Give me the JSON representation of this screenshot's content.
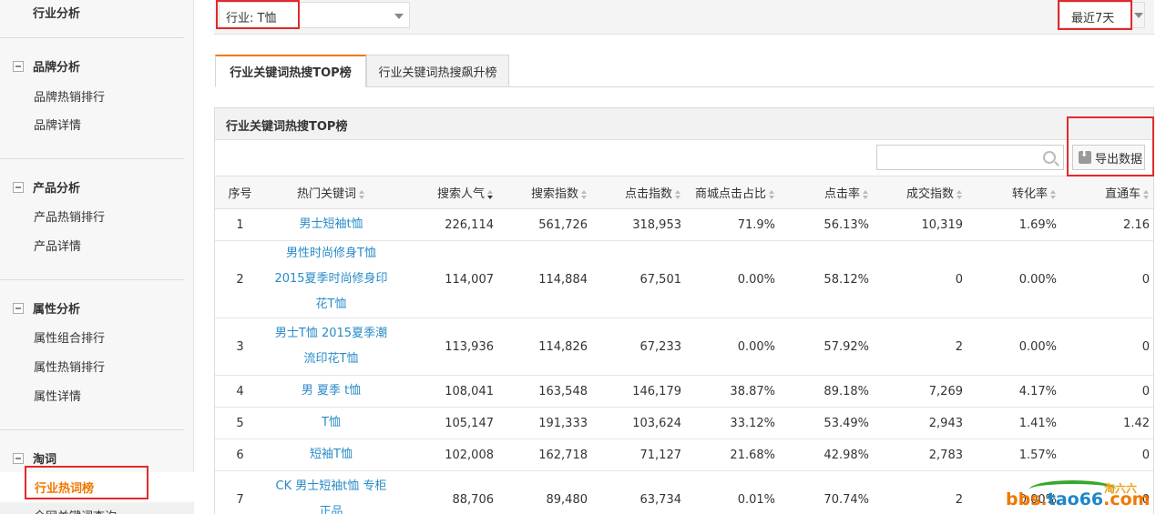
{
  "sidebar": {
    "top_label": "行业分析",
    "groups": [
      {
        "title": "品牌分析",
        "items": [
          "品牌热销排行",
          "品牌详情"
        ]
      },
      {
        "title": "产品分析",
        "items": [
          "产品热销排行",
          "产品详情"
        ]
      },
      {
        "title": "属性分析",
        "items": [
          "属性组合排行",
          "属性热销排行",
          "属性详情"
        ]
      },
      {
        "title": "淘词",
        "items": [
          "行业热词榜",
          "全网关键词查询"
        ]
      }
    ],
    "active_item": "行业热词榜"
  },
  "filters": {
    "industry_label": "行业: T恤",
    "time_range": "最近7天"
  },
  "tabs": [
    {
      "label": "行业关键词热搜TOP榜",
      "active": true
    },
    {
      "label": "行业关键词热搜飙升榜",
      "active": false
    }
  ],
  "panel": {
    "title": "行业关键词热搜TOP榜",
    "search_placeholder": "",
    "export_label": "导出数据"
  },
  "table": {
    "headers": [
      "序号",
      "热门关键词",
      "搜索人气",
      "搜索指数",
      "点击指数",
      "商城点击占比",
      "点击率",
      "成交指数",
      "转化率",
      "直通车"
    ],
    "rows": [
      [
        "1",
        "男士短袖t恤",
        "226,114",
        "561,726",
        "318,953",
        "71.9%",
        "56.13%",
        "10,319",
        "1.69%",
        "2.16"
      ],
      [
        "2",
        "男性时尚修身T恤 2015夏季时尚修身印花T恤",
        "114,007",
        "114,884",
        "67,501",
        "0.00%",
        "58.12%",
        "0",
        "0.00%",
        "0"
      ],
      [
        "3",
        "男士T恤 2015夏季潮流印花T恤",
        "113,936",
        "114,826",
        "67,233",
        "0.00%",
        "57.92%",
        "2",
        "0.00%",
        "0"
      ],
      [
        "4",
        "男 夏季 t恤",
        "108,041",
        "163,548",
        "146,179",
        "38.87%",
        "89.18%",
        "7,269",
        "4.17%",
        "0"
      ],
      [
        "5",
        "T恤",
        "105,147",
        "191,333",
        "103,624",
        "33.12%",
        "53.49%",
        "2,943",
        "1.41%",
        "1.42"
      ],
      [
        "6",
        "短袖T恤",
        "102,008",
        "162,718",
        "71,127",
        "21.68%",
        "42.98%",
        "2,783",
        "1.57%",
        "0"
      ],
      [
        "7",
        "CK 男士短袖t恤 专柜正品",
        "88,706",
        "89,480",
        "63,734",
        "0.01%",
        "70.74%",
        "2",
        "0.00%",
        "0"
      ]
    ]
  },
  "watermark": {
    "cn": "淘六六",
    "text_a": "bbs.",
    "text_b": "tao66",
    "text_c": ".com"
  },
  "colors": {
    "accent": "#f07800",
    "link": "#2a8bc8",
    "highlight_box": "#e2292b"
  }
}
